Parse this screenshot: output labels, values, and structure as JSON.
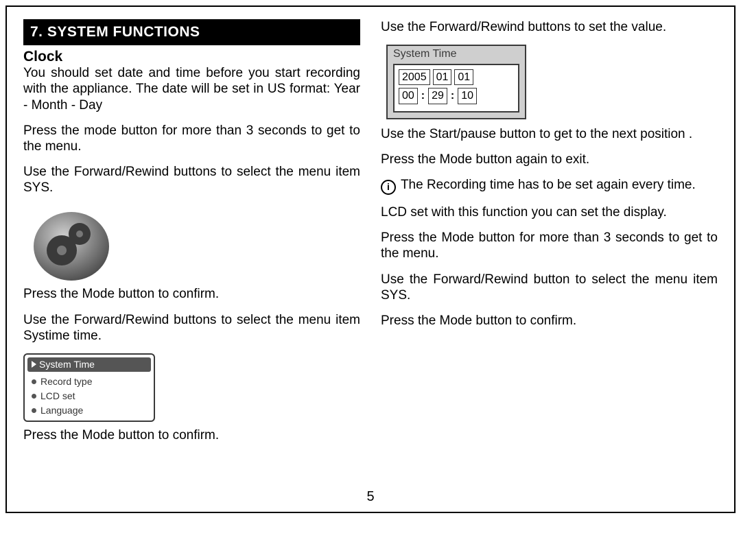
{
  "header": {
    "title": "7. SYSTEM FUNCTIONS"
  },
  "left": {
    "subhead": "Clock",
    "p1": "You should set date and time before you start recording with the appliance. The date will be set in US format: Year - Month - Day",
    "p2": "Press the mode button for more than 3 seconds to get to the menu.",
    "p3": "Use the Forward/Rewind buttons to select the menu item SYS.",
    "p4": "Press the Mode button to confirm.",
    "p5": "Use the Forward/Rewind buttons to select the menu item Systime time.",
    "menu": {
      "head": "System Time",
      "items": [
        "Record type",
        "LCD set",
        "Language"
      ]
    },
    "p6": "Press the Mode button to confirm."
  },
  "right": {
    "p1": "Use the Forward/Rewind buttons to set the value.",
    "systime": {
      "title": "System Time",
      "date": [
        "2005",
        "01",
        "01"
      ],
      "time": [
        "00",
        "29",
        "10"
      ]
    },
    "p2": "Use the Start/pause button to get to the next position .",
    "p3": "Press the Mode button again to exit.",
    "info": "The Recording time has to be set again every time.",
    "p4": "LCD set with this function you can set the display.",
    "p5": "Press the Mode button for more than 3 seconds to get to the menu.",
    "p6": "Use the Forward/Rewind button to select the menu item SYS.",
    "p7": "Press the Mode button to confirm."
  },
  "page_number": "5"
}
